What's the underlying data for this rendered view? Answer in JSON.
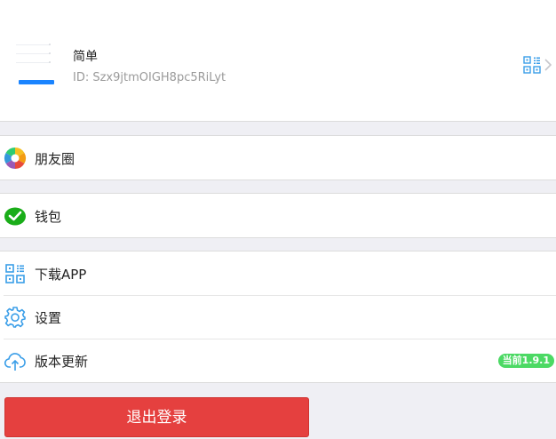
{
  "profile": {
    "name": "简单",
    "id": "ID: Szx9jtmOIGH8pc5RiLyt",
    "qr_icon": "qr-code-icon",
    "chevron_icon": "chevron-right-icon"
  },
  "menu": {
    "moments": {
      "label": "朋友圈",
      "icon": "moments-aperture-icon"
    },
    "wallet": {
      "label": "钱包",
      "icon": "wallet-icon"
    },
    "download": {
      "label": "下载APP",
      "icon": "qr-code-icon"
    },
    "settings": {
      "label": "设置",
      "icon": "gear-icon"
    },
    "update": {
      "label": "版本更新",
      "icon": "cloud-upload-icon",
      "badge": "当前1.9.1"
    }
  },
  "logout_label": "退出登录",
  "colors": {
    "accent_blue": "#3a9ee8",
    "logout_red": "#e5403f",
    "badge_green": "#4cd964",
    "wallet_green": "#1aad19",
    "background": "#efeff4"
  }
}
